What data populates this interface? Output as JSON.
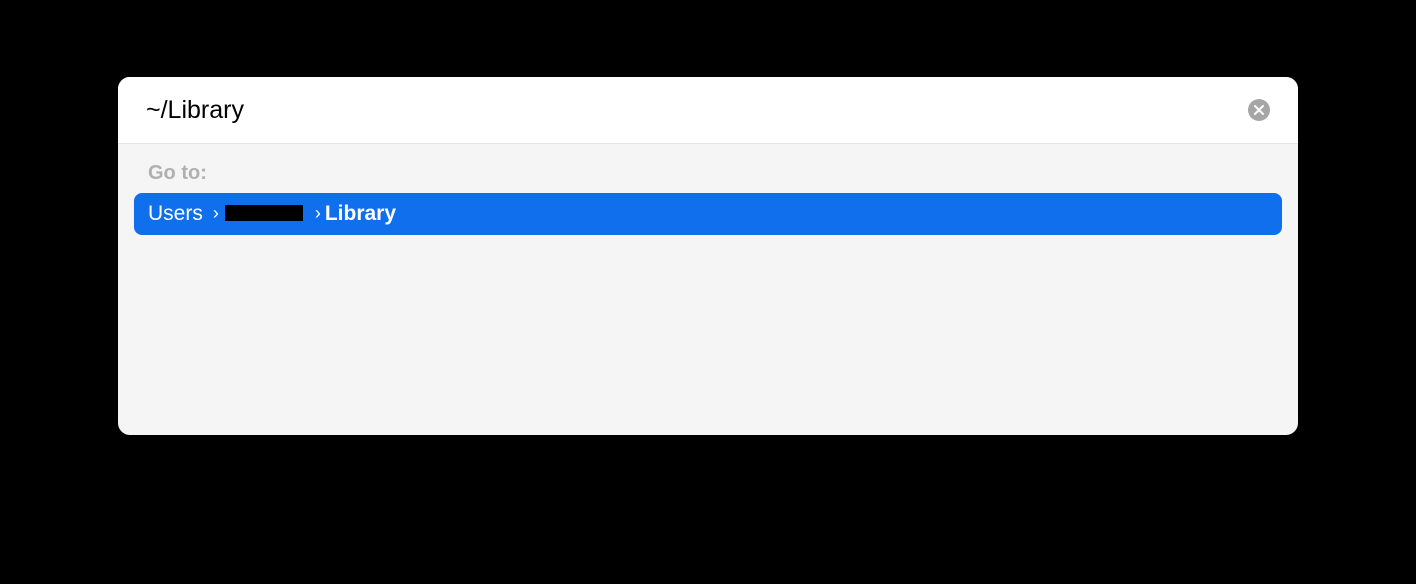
{
  "input": {
    "value": "~/Library"
  },
  "section": {
    "label": "Go to:"
  },
  "result": {
    "segments": [
      {
        "text": "Users",
        "bold": false,
        "redacted": false
      },
      {
        "text": "",
        "bold": false,
        "redacted": true
      },
      {
        "text": "Library",
        "bold": true,
        "redacted": false
      }
    ],
    "separator": "›"
  },
  "colors": {
    "selection": "#0f6fec",
    "background": "#f5f5f5"
  }
}
